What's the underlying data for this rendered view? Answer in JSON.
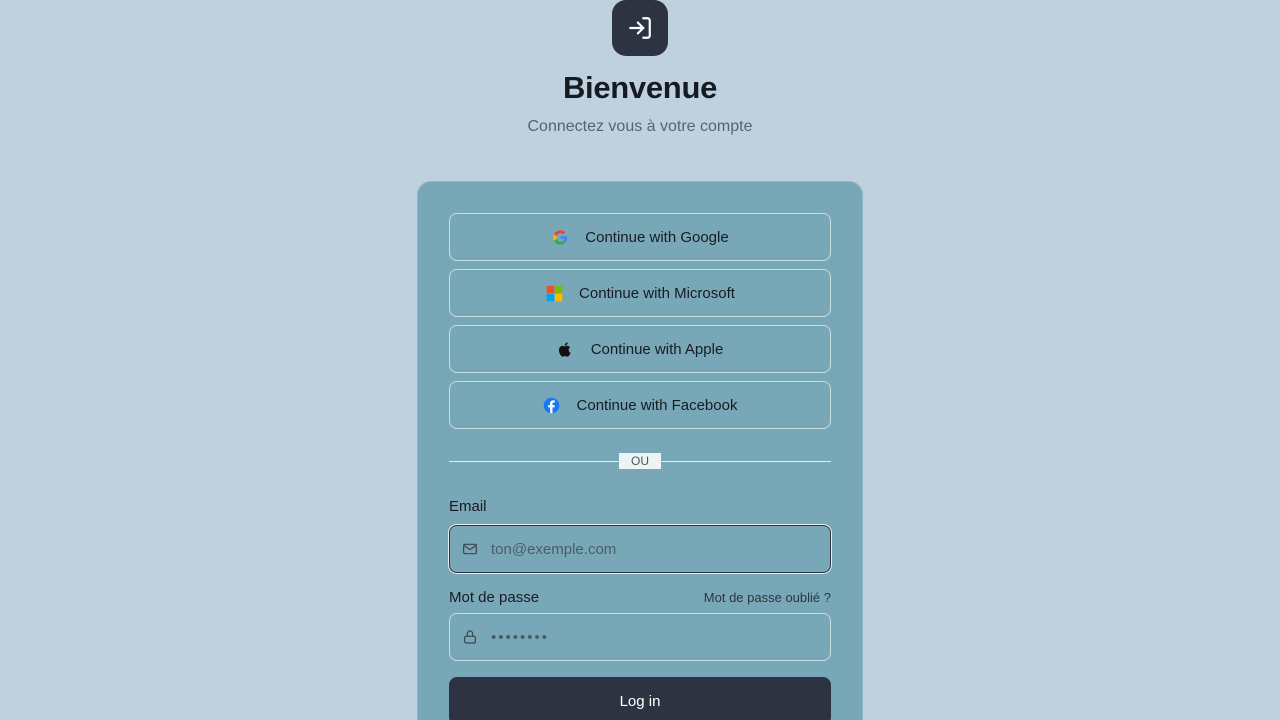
{
  "header": {
    "logo_icon": "login-arrow-icon",
    "title": "Bienvenue",
    "subtitle": "Connectez vous à votre compte"
  },
  "social": [
    {
      "label": "Continue with Google",
      "icon": "google-icon"
    },
    {
      "label": "Continue with Microsoft",
      "icon": "microsoft-icon"
    },
    {
      "label": "Continue with Apple",
      "icon": "apple-icon"
    },
    {
      "label": "Continue with Facebook",
      "icon": "facebook-icon"
    }
  ],
  "divider": {
    "label": "OU"
  },
  "form": {
    "email_label": "Email",
    "email_placeholder": "ton@exemple.com",
    "email_icon": "mail-icon",
    "password_label": "Mot de passe",
    "forgot_label": "Mot de passe oublié ?",
    "password_placeholder": "••••••••",
    "password_icon": "lock-icon",
    "submit_label": "Log in"
  },
  "colors": {
    "background": "#bfd1df",
    "card": "#78a8b7",
    "primary_dark": "#2d3340"
  }
}
